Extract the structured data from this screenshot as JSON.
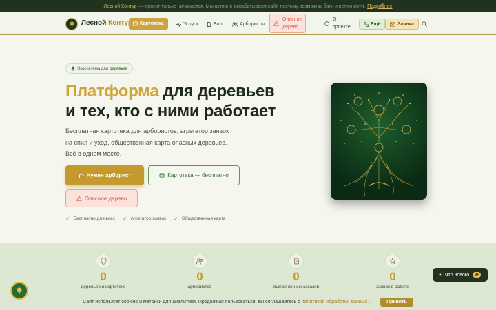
{
  "banner": {
    "brand": "Лесной Контур",
    "text": "— проект только начинается. Мы активно дорабатываем сайт, поэтому возможны баги и неточности.",
    "more_link": "Подробнее",
    "close_icon": "×"
  },
  "nav": {
    "logo_main": "Лесной",
    "logo_accent": "Контур",
    "items": [
      {
        "label": "Картотека",
        "icon": "card-icon",
        "state": "active"
      },
      {
        "label": "Услуги",
        "icon": "pulse-icon"
      },
      {
        "label": "Блог",
        "icon": "document-icon"
      },
      {
        "label": "Арбористы",
        "icon": "users-icon"
      },
      {
        "label_line1": "Опасное",
        "label_line2": "дерево",
        "icon": "warning-icon",
        "state": "danger"
      },
      {
        "label_line1": "О",
        "label_line2": "проекте",
        "icon": "info-icon"
      },
      {
        "label": "Ещё",
        "icon": "dots-icon"
      },
      {
        "label": "Заявка",
        "icon": "mail-icon"
      }
    ],
    "search_icon": "search-icon"
  },
  "hero": {
    "badge": "Экосистема для деревьев",
    "title_accent": "Платформа",
    "title_rest_line1": " для деревьев",
    "title_line2": "и тех, кто с ними работает",
    "lead_lines": [
      "Бесплатная картотека для арбористов, агрегатор заявок",
      "на спил и уход, общественная карта опасных деревьев.",
      "Всё в одном месте."
    ],
    "btn_primary": "Нужен арборист",
    "btn_secondary": "Картотека — бесплатно",
    "btn_danger": "Опасное дерево",
    "features": [
      "Бесплатно для всех",
      "Агрегатор заявок",
      "Общественная карта"
    ]
  },
  "stats": [
    {
      "value": "0",
      "label": "деревьев в картотеке",
      "icon": "shield-icon"
    },
    {
      "value": "0",
      "label": "арбористов",
      "icon": "users-icon"
    },
    {
      "value": "0",
      "label": "выполненных заказов",
      "icon": "document-icon"
    },
    {
      "value": "0",
      "label": "заявок в работе",
      "icon": "star-icon"
    }
  ],
  "cookie": {
    "text": "Сайт использует cookies и метрики для аналитики. Продолжая пользоваться, вы соглашаетесь с",
    "link": "политикой обработки данных",
    "dot": ".",
    "accept": "Принять"
  },
  "whats_new": {
    "label": "Что нового",
    "badge": "9+"
  },
  "colors": {
    "accent": "#c49a2e",
    "forest": "#21331f",
    "danger": "#d35b4b"
  }
}
